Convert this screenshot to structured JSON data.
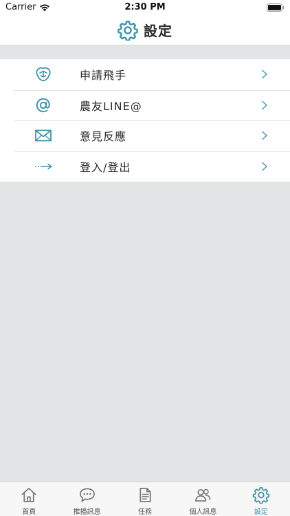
{
  "status_bar": {
    "carrier": "Carrier",
    "time": "2:30 PM",
    "icons": [
      "wifi-icon",
      "battery-icon"
    ]
  },
  "nav": {
    "title": "設定",
    "icon": "gear-icon"
  },
  "menu": {
    "items": [
      {
        "label": "申請飛手",
        "icon": "drone-badge-icon"
      },
      {
        "label": "農友LINE@",
        "icon": "at-sign-icon"
      },
      {
        "label": "意見反應",
        "icon": "envelope-icon"
      },
      {
        "label": "登入/登出",
        "icon": "arrow-right-icon"
      }
    ]
  },
  "tab_bar": {
    "tabs": [
      {
        "label": "首頁",
        "icon": "home-icon",
        "active": false
      },
      {
        "label": "推播訊息",
        "icon": "chat-bubble-icon",
        "active": false
      },
      {
        "label": "任務",
        "icon": "document-icon",
        "active": false
      },
      {
        "label": "個人訊息",
        "icon": "people-icon",
        "active": false
      },
      {
        "label": "設定",
        "icon": "gear-icon",
        "active": true
      }
    ]
  },
  "colors": {
    "accent": "#3f94a8",
    "background": "#e3e4e6",
    "surface": "#ffffff",
    "tab_inactive": "#555555"
  }
}
